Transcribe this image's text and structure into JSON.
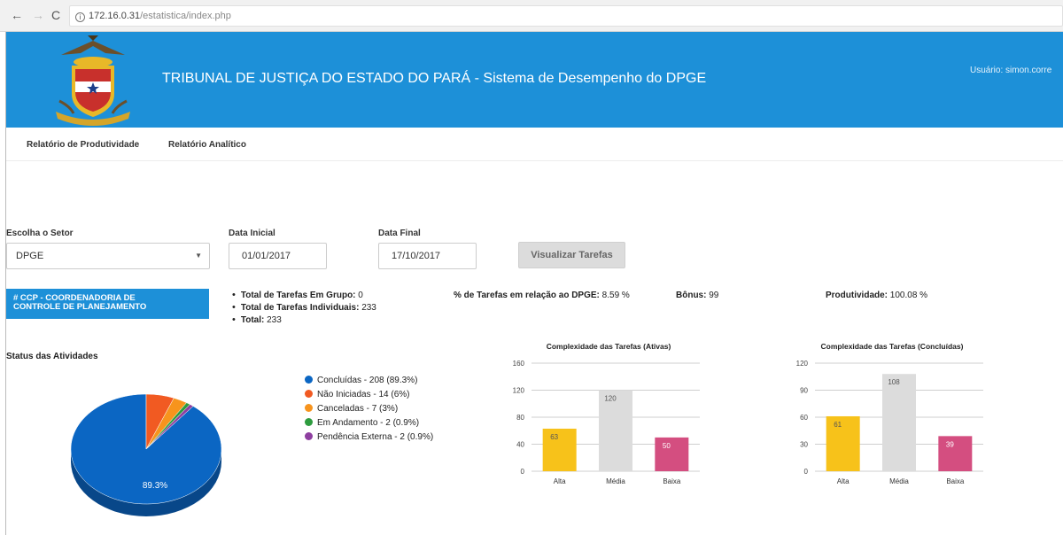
{
  "browser": {
    "host": "172.16.0.31",
    "path": "/estatistica/index.php"
  },
  "header": {
    "title": "TRIBUNAL DE JUSTIÇA DO ESTADO DO PARÁ - Sistema de Desempenho do DPGE",
    "user": "Usuário: simon.corre",
    "accent": "#1d90d8"
  },
  "menu": {
    "items": [
      "Relatório de Produtividade",
      "Relatório Analítico"
    ]
  },
  "form": {
    "sector_label": "Escolha o Setor",
    "sector_value": "DPGE",
    "start_label": "Data Inicial",
    "start_value": "01/01/2017",
    "end_label": "Data Final",
    "end_value": "17/10/2017",
    "submit_label": "Visualizar Tarefas"
  },
  "sector": {
    "name_line1": "# CCP - COORDENADORIA DE",
    "name_line2": "CONTROLE DE PLANEJAMENTO"
  },
  "stats": {
    "group_label": "Total de Tarefas Em Grupo:",
    "group_value": "0",
    "individual_label": "Total de Tarefas Individuais:",
    "individual_value": "233",
    "total_label": "Total:",
    "total_value": "233",
    "pct_label": "% de Tarefas em relação ao DPGE:",
    "pct_value": "8.59 %",
    "bonus_label": "Bônus:",
    "bonus_value": "99",
    "prod_label": "Produtividade:",
    "prod_value": "100.08 %"
  },
  "status_title": "Status das Atividades",
  "chart_data": [
    {
      "type": "pie",
      "title": "Status das Atividades",
      "slices": [
        {
          "label": "Concluídas - 208 (89.3%)",
          "value": 208,
          "color": "#0b66c3"
        },
        {
          "label": "Não Iniciadas - 14 (6%)",
          "value": 14,
          "color": "#f15a22"
        },
        {
          "label": "Canceladas - 7 (3%)",
          "value": 7,
          "color": "#f7941d"
        },
        {
          "label": "Em Andamento - 2 (0.9%)",
          "value": 2,
          "color": "#2e9c3f"
        },
        {
          "label": "Pendência Externa - 2 (0.9%)",
          "value": 2,
          "color": "#8e3fa0"
        }
      ],
      "data_label": "89.3%"
    },
    {
      "type": "bar",
      "title": "Complexidade das Tarefas (Ativas)",
      "categories": [
        "Alta",
        "Média",
        "Baixa"
      ],
      "values": [
        63,
        120,
        50
      ],
      "colors": [
        "#f7c21a",
        "#dcdcdc",
        "#d44e80"
      ],
      "ylim": [
        0,
        160
      ],
      "yticks": [
        "0",
        "40",
        "80",
        "120",
        "160"
      ]
    },
    {
      "type": "bar",
      "title": "Complexidade das Tarefas (Concluídas)",
      "categories": [
        "Alta",
        "Média",
        "Baixa"
      ],
      "values": [
        61,
        108,
        39
      ],
      "colors": [
        "#f7c21a",
        "#dcdcdc",
        "#d44e80"
      ],
      "ylim": [
        0,
        120
      ],
      "yticks": [
        "0",
        "30",
        "60",
        "90",
        "120"
      ]
    }
  ]
}
